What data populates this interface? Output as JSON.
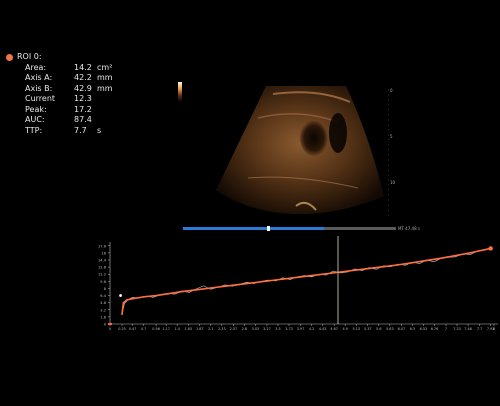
{
  "roi": {
    "title": "ROI 0:",
    "color": "#f07848",
    "rows": [
      {
        "label": "Area:",
        "value": "14.2",
        "unit": "cm²"
      },
      {
        "label": "Axis A:",
        "value": "42.2",
        "unit": "mm"
      },
      {
        "label": "Axis B:",
        "value": "42.9",
        "unit": "mm"
      },
      {
        "label": "Current",
        "value": "12.3",
        "unit": ""
      },
      {
        "label": "Peak:",
        "value": "17.2",
        "unit": ""
      },
      {
        "label": "AUC:",
        "value": "87.4",
        "unit": ""
      },
      {
        "label": "TTP:",
        "value": "7.7",
        "unit": "s"
      }
    ]
  },
  "image": {
    "time_readout": "MT 47.48 s",
    "depth_labels": [
      "0",
      "5",
      "10"
    ],
    "scroll_position": 0.66
  },
  "chart_data": {
    "type": "line",
    "xlim": [
      0,
      8.0
    ],
    "ylim": [
      0,
      18
    ],
    "x_ticks": [
      "0",
      "0.25",
      "0.47",
      "0.7",
      "0.96",
      "1.17",
      "1.4",
      "1.63",
      "1.87",
      "2.1",
      "2.33",
      "2.57",
      "2.8",
      "3.03",
      "3.27",
      "3.5",
      "3.73",
      "3.97",
      "4.2",
      "4.43",
      "4.67",
      "4.9",
      "5.13",
      "5.37",
      "5.6",
      "5.83",
      "6.07",
      "6.3",
      "6.53",
      "6.76",
      "7",
      "7.23",
      "7.46",
      "7.7",
      "7.93",
      "8"
    ],
    "y_ticks": [
      "0",
      "1.6",
      "3.2",
      "4.8",
      "6.4",
      "8",
      "9.6",
      "11.2",
      "12.8",
      "14.4",
      "16",
      "17.6"
    ],
    "cursor_x": 4.75,
    "series": [
      {
        "color": "#ff7040",
        "x": [
          0.25,
          0.28,
          0.35,
          0.47,
          0.7,
          0.96,
          1.2,
          1.5,
          1.8,
          2.1,
          2.4,
          2.7,
          3.0,
          3.3,
          3.6,
          3.9,
          4.2,
          4.5,
          4.8,
          5.1,
          5.4,
          5.7,
          6.0,
          6.3,
          6.6,
          6.9,
          7.2,
          7.5,
          7.93
        ],
        "y": [
          2.2,
          4.8,
          5.4,
          5.7,
          6.1,
          6.4,
          6.8,
          7.3,
          7.7,
          8.1,
          8.5,
          8.9,
          9.3,
          9.7,
          10.1,
          10.5,
          10.9,
          11.3,
          11.7,
          12.1,
          12.5,
          12.9,
          13.3,
          13.8,
          14.3,
          14.8,
          15.4,
          16.0,
          17.0
        ]
      },
      {
        "color": "#c8c8c8",
        "x": [
          0.25,
          0.3,
          0.38,
          0.47,
          0.6,
          0.75,
          0.9,
          1.05,
          1.2,
          1.35,
          1.5,
          1.65,
          1.8,
          1.95,
          2.1,
          2.25,
          2.4,
          2.55,
          2.7,
          2.85,
          3.0,
          3.15,
          3.3,
          3.45,
          3.6,
          3.75,
          3.9,
          4.05,
          4.2,
          4.35,
          4.5,
          4.65,
          4.8,
          4.95,
          5.1,
          5.25,
          5.4,
          5.55,
          5.7,
          5.85,
          6.0,
          6.15,
          6.3,
          6.45,
          6.6,
          6.75,
          6.9,
          7.05,
          7.2,
          7.35,
          7.5,
          7.65,
          7.8,
          7.93
        ],
        "y": [
          2.0,
          4.6,
          5.5,
          6.0,
          5.8,
          6.3,
          6.0,
          6.6,
          6.9,
          6.7,
          7.4,
          7.1,
          7.9,
          8.6,
          7.8,
          8.3,
          8.8,
          8.5,
          8.9,
          9.4,
          9.1,
          9.6,
          9.9,
          9.7,
          10.4,
          10.0,
          10.6,
          10.9,
          10.6,
          11.2,
          11.0,
          11.9,
          11.5,
          11.7,
          12.4,
          12.0,
          12.7,
          12.3,
          13.1,
          12.9,
          13.5,
          13.2,
          13.9,
          13.6,
          14.4,
          14.0,
          14.8,
          15.0,
          15.1,
          15.8,
          15.6,
          16.4,
          16.6,
          17.2
        ]
      }
    ]
  }
}
